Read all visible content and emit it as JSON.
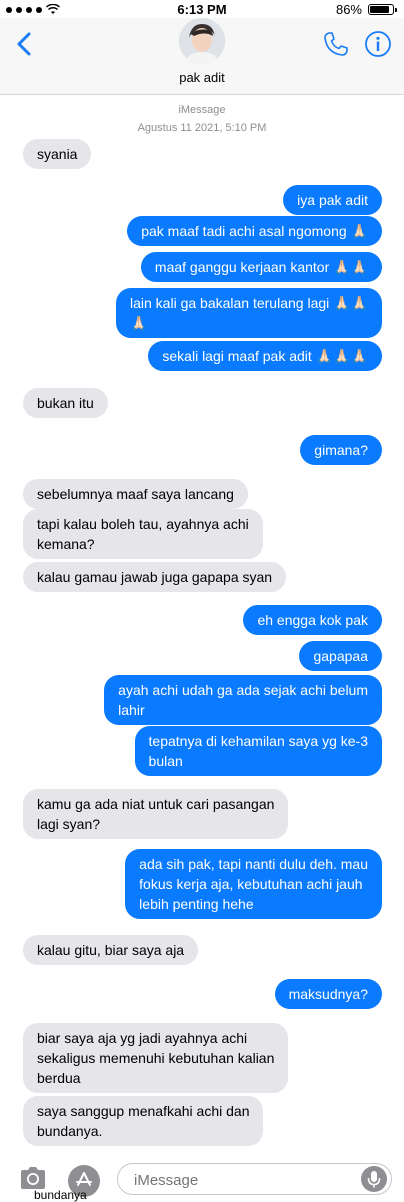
{
  "status_bar": {
    "time": "6:13 PM",
    "battery": "86%",
    "battery_level": 0.86
  },
  "header": {
    "contact_name": "pak adit",
    "back_icon": "chevron-left-icon",
    "call_icon": "phone-icon",
    "info_icon": "info-icon"
  },
  "thread": {
    "service": "iMessage",
    "date": "Agustus 11 2021, 5:10 PM",
    "messages": [
      {
        "dir": "in",
        "text": "syania"
      },
      {
        "dir": "out",
        "text": "iya pak adit"
      },
      {
        "dir": "out",
        "text": "pak maaf tadi achi asal ngomong 🙏🏻"
      },
      {
        "dir": "out",
        "text": "maaf ganggu kerjaan kantor 🙏🏻🙏🏻"
      },
      {
        "dir": "out",
        "text": "lain kali ga bakalan terulang lagi 🙏🏻🙏🏻\n🙏🏻"
      },
      {
        "dir": "out",
        "text": "sekali lagi maaf pak adit 🙏🏻🙏🏻🙏🏻"
      },
      {
        "dir": "in",
        "text": "bukan itu"
      },
      {
        "dir": "out",
        "text": "gimana?"
      },
      {
        "dir": "in",
        "text": "sebelumnya maaf saya lancang"
      },
      {
        "dir": "in",
        "text": "tapi kalau boleh tau, ayahnya achi\nkemana?"
      },
      {
        "dir": "in",
        "text": "kalau gamau jawab juga gapapa syan"
      },
      {
        "dir": "out",
        "text": "eh engga kok pak"
      },
      {
        "dir": "out",
        "text": "gapapaa"
      },
      {
        "dir": "out",
        "text": "ayah achi udah ga ada sejak achi belum\nlahir"
      },
      {
        "dir": "out",
        "text": "tepatnya di kehamilan saya yg ke-3\nbulan"
      },
      {
        "dir": "in",
        "text": "kamu ga ada niat untuk cari pasangan\nlagi syan?"
      },
      {
        "dir": "out",
        "text": "ada sih pak, tapi nanti dulu deh. mau\nfokus kerja aja, kebutuhan achi jauh\nlebih penting hehe"
      },
      {
        "dir": "in",
        "text": "kalau gitu, biar saya aja"
      },
      {
        "dir": "out",
        "text": "maksudnya?"
      },
      {
        "dir": "in",
        "text": "biar saya aja yg jadi ayahnya achi\nsekaligus memenuhi kebutuhan kalian\nberdua"
      },
      {
        "dir": "in",
        "text": "saya sanggup menafkahi achi dan\nbundanya."
      }
    ],
    "peek_text": "bundanya"
  },
  "input_bar": {
    "placeholder": "iMessage",
    "camera_icon": "camera-icon",
    "apps_icon": "app-store-icon",
    "mic_icon": "microphone-icon"
  },
  "colors": {
    "outgoing": "#0a7aff",
    "incoming": "#e5e5ea",
    "accent": "#1a7cf5"
  }
}
